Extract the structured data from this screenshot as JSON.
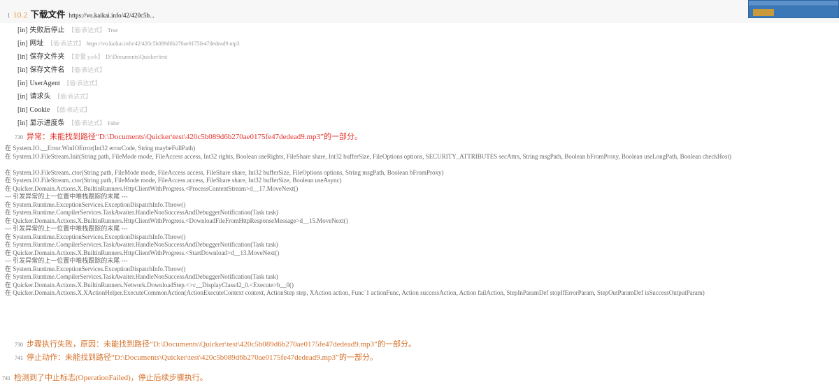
{
  "step": {
    "index": "1",
    "number": "10.2",
    "title": "下载文件",
    "url": "https://vo.kaikai.info/42/420c5b..."
  },
  "widget": {
    "title": "运行查询",
    "badge": "运行中"
  },
  "params": [
    {
      "dir": "[in]",
      "name": "失败后停止",
      "type": "【值/表达式】",
      "value": "True"
    },
    {
      "dir": "[in]",
      "name": "网址",
      "type": "【值/表达式】",
      "value": "https://vo.kaikai.info/42/420c5b089d6b270ae0175fe47dedead9.mp3"
    },
    {
      "dir": "[in]",
      "name": "保存文件夹",
      "type": "【变量 path】",
      "value": "D:\\Documents\\Quicker\\test"
    },
    {
      "dir": "[in]",
      "name": "保存文件名",
      "type": "【值/表达式】",
      "value": ""
    },
    {
      "dir": "[in]",
      "name": "UserAgent",
      "type": "【值/表达式】",
      "value": ""
    },
    {
      "dir": "[in]",
      "name": "请求头",
      "type": "【值/表达式】",
      "value": ""
    },
    {
      "dir": "[in]",
      "name": "Cookie",
      "type": "【值/表达式】",
      "value": ""
    },
    {
      "dir": "[in]",
      "name": "显示进度条",
      "type": "【值/表达式】",
      "value": "False"
    }
  ],
  "error": {
    "line": "730",
    "text": "异常：未能找到路径“D:\\Documents\\Quicker\\test\\420c5b089d6b270ae0175fe47dedead9.mp3”的一部分。"
  },
  "stack": [
    "在 System.IO.__Error.WinIOError(Int32 errorCode, String maybeFullPath)",
    "在 System.IO.FileStream.Init(String path, FileMode mode, FileAccess access, Int32 rights, Boolean useRights, FileShare share, Int32 bufferSize, FileOptions options, SECURITY_ATTRIBUTES secAttrs, String msgPath, Boolean bFromProxy, Boolean useLongPath, Boolean checkHost)",
    "在 System.IO.FileStream..ctor(String path, FileMode mode, FileAccess access, FileShare share, Int32 bufferSize, FileOptions options, String msgPath, Boolean bFromProxy)",
    "在 System.IO.FileStream..ctor(String path, FileMode mode, FileAccess access, FileShare share, Int32 bufferSize, Boolean useAsync)",
    "在 Quicker.Domain.Actions.X.BuiltinRunners.HttpClientWithProgress.<ProcessContentStream>d__17.MoveNext()",
    "--- 引发异常的上一位置中堆栈跟踪的末尾 ---",
    "在 System.Runtime.ExceptionServices.ExceptionDispatchInfo.Throw()",
    "在 System.Runtime.CompilerServices.TaskAwaiter.HandleNonSuccessAndDebuggerNotification(Task task)",
    "在 Quicker.Domain.Actions.X.BuiltinRunners.HttpClientWithProgress.<DownloadFileFromHttpResponseMessage>d__15.MoveNext()",
    "--- 引发异常的上一位置中堆栈跟踪的末尾 ---",
    "在 System.Runtime.ExceptionServices.ExceptionDispatchInfo.Throw()",
    "在 System.Runtime.CompilerServices.TaskAwaiter.HandleNonSuccessAndDebuggerNotification(Task task)",
    "在 Quicker.Domain.Actions.X.BuiltinRunners.HttpClientWithProgress.<StartDownload>d__13.MoveNext()",
    "--- 引发异常的上一位置中堆栈跟踪的末尾 ---",
    "在 System.Runtime.ExceptionServices.ExceptionDispatchInfo.Throw()",
    "在 System.Runtime.CompilerServices.TaskAwaiter.HandleNonSuccessAndDebuggerNotification(Task task)",
    "在 Quicker.Domain.Actions.X.BuiltinRunners.Network.DownloadStep.<>c__DisplayClass42_0.<Execute>b__0()",
    "在 Quicker.Domain.Actions.X.XActionHelper.ExecuteCommonAction(ActionExecuteContext context, ActionStep step, XAction action, Func`1 actionFunc, Action successAction, Action failAction, StepInParamDef stopIfErrorParam, StepOutParamDef isSuccessOutputParam)"
  ],
  "fail": {
    "line": "730",
    "text": "步骤执行失败，原因：未能找到路径“D:\\Documents\\Quicker\\test\\420c5b089d6b270ae0175fe47dedead9.mp3”的一部分。"
  },
  "stop": {
    "line": "741",
    "text": "停止动作：未能找到路径“D:\\Documents\\Quicker\\test\\420c5b089d6b270ae0175fe47dedead9.mp3”的一部分。"
  },
  "final": {
    "line": "741",
    "text": "检测到了中止标志(OperationFailed)，停止后续步骤执行。"
  }
}
